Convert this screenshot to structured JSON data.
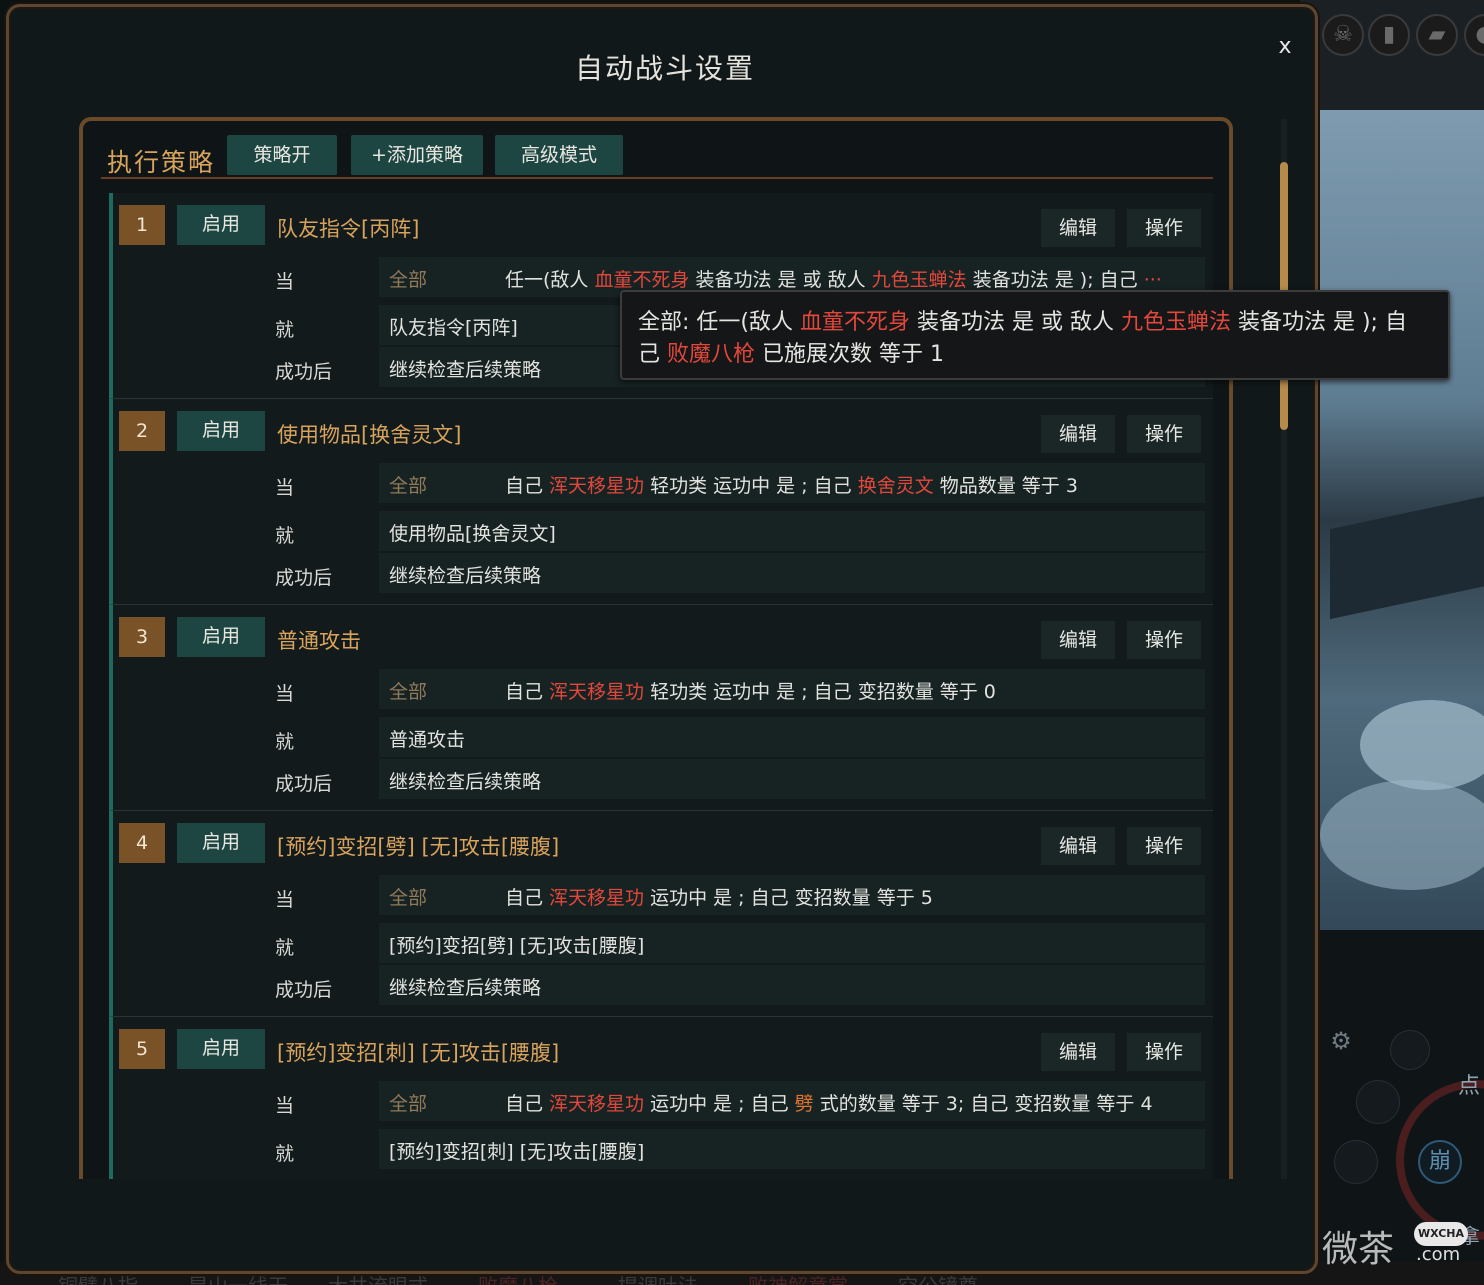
{
  "dialog": {
    "title": "自动战斗设置",
    "close": "x"
  },
  "toolbar": {
    "label": "执行策略",
    "buttons": [
      "策略开",
      "+添加策略",
      "高级模式"
    ]
  },
  "labels": {
    "when": "当",
    "then": "就",
    "after_success": "成功后",
    "enable": "启用",
    "edit": "编辑",
    "operate": "操作",
    "all": "全部"
  },
  "strategies": [
    {
      "num": "1",
      "name": "队友指令[丙阵]",
      "condition": [
        {
          "t": "任一(敌人 ",
          "c": ""
        },
        {
          "t": "血童不死身",
          "c": "red"
        },
        {
          "t": " 装备功法 是 或 敌人 ",
          "c": ""
        },
        {
          "t": "九色玉蝉法",
          "c": "red"
        },
        {
          "t": " 装备功法 是 ); 自己 ",
          "c": ""
        },
        {
          "t": "···",
          "c": "red"
        }
      ],
      "action": "队友指令[丙阵]",
      "after": "继续检查后续策略"
    },
    {
      "num": "2",
      "name": "使用物品[换舍灵文]",
      "condition": [
        {
          "t": "自己 ",
          "c": ""
        },
        {
          "t": "浑天移星功",
          "c": "red"
        },
        {
          "t": " 轻功类 运功中 是 ; 自己 ",
          "c": ""
        },
        {
          "t": "换舍灵文",
          "c": "red"
        },
        {
          "t": " 物品数量 等于 3",
          "c": ""
        }
      ],
      "action": "使用物品[换舍灵文]",
      "after": "继续检查后续策略"
    },
    {
      "num": "3",
      "name": "普通攻击",
      "condition": [
        {
          "t": "自己 ",
          "c": ""
        },
        {
          "t": "浑天移星功",
          "c": "red"
        },
        {
          "t": " 轻功类 运功中 是 ; 自己 变招数量 等于 0",
          "c": ""
        }
      ],
      "action": "普通攻击",
      "after": "继续检查后续策略"
    },
    {
      "num": "4",
      "name": "[预约]变招[劈] [无]攻击[腰腹]",
      "condition": [
        {
          "t": "自己 ",
          "c": ""
        },
        {
          "t": "浑天移星功",
          "c": "red"
        },
        {
          "t": " 运功中 是 ; 自己 变招数量 等于 5",
          "c": ""
        }
      ],
      "action": "[预约]变招[劈] [无]攻击[腰腹]",
      "after": "继续检查后续策略"
    },
    {
      "num": "5",
      "name": "[预约]变招[刺] [无]攻击[腰腹]",
      "condition": [
        {
          "t": "自己 ",
          "c": ""
        },
        {
          "t": "浑天移星功",
          "c": "red"
        },
        {
          "t": " 运功中 是 ; 自己 ",
          "c": ""
        },
        {
          "t": "劈",
          "c": "orange"
        },
        {
          "t": " 式的数量 等于 3; 自己 变招数量 等于 4",
          "c": ""
        }
      ],
      "action": "[预约]变招[刺] [无]攻击[腰腹]",
      "after": ""
    }
  ],
  "tooltip": {
    "line1": [
      {
        "t": "全部: 任一(敌人 ",
        "c": ""
      },
      {
        "t": "血童不死身",
        "c": "red"
      },
      {
        "t": " 装备功法 是 或 敌人 ",
        "c": ""
      },
      {
        "t": "九色玉蝉法",
        "c": "red"
      },
      {
        "t": " 装备功法 是 ); 自",
        "c": ""
      }
    ],
    "line2": [
      {
        "t": "己 ",
        "c": ""
      },
      {
        "t": "败魔八枪",
        "c": "red"
      },
      {
        "t": " 已施展次数 等于 1",
        "c": ""
      }
    ]
  },
  "game": {
    "side_chars": [
      "点",
      "崩",
      "拿"
    ],
    "bottom_tabs": [
      "铜擘八指",
      "昆山一线天",
      "大共流眼式",
      "败魔八枪",
      "提调吐法",
      "败神解意掌",
      "空公镜尊"
    ]
  },
  "watermark": {
    "brand": "微茶",
    "badge": "WXCHA",
    "domain": ".com"
  },
  "colors": {
    "accent_gold": "#d8a35c",
    "button_teal": "#1d4642",
    "highlight_red": "#e2473b",
    "highlight_orange": "#e0752e",
    "success_teal": "#46b498",
    "number_badge": "#7a5227"
  },
  "icons": [
    "close-icon",
    "gear-icon"
  ]
}
